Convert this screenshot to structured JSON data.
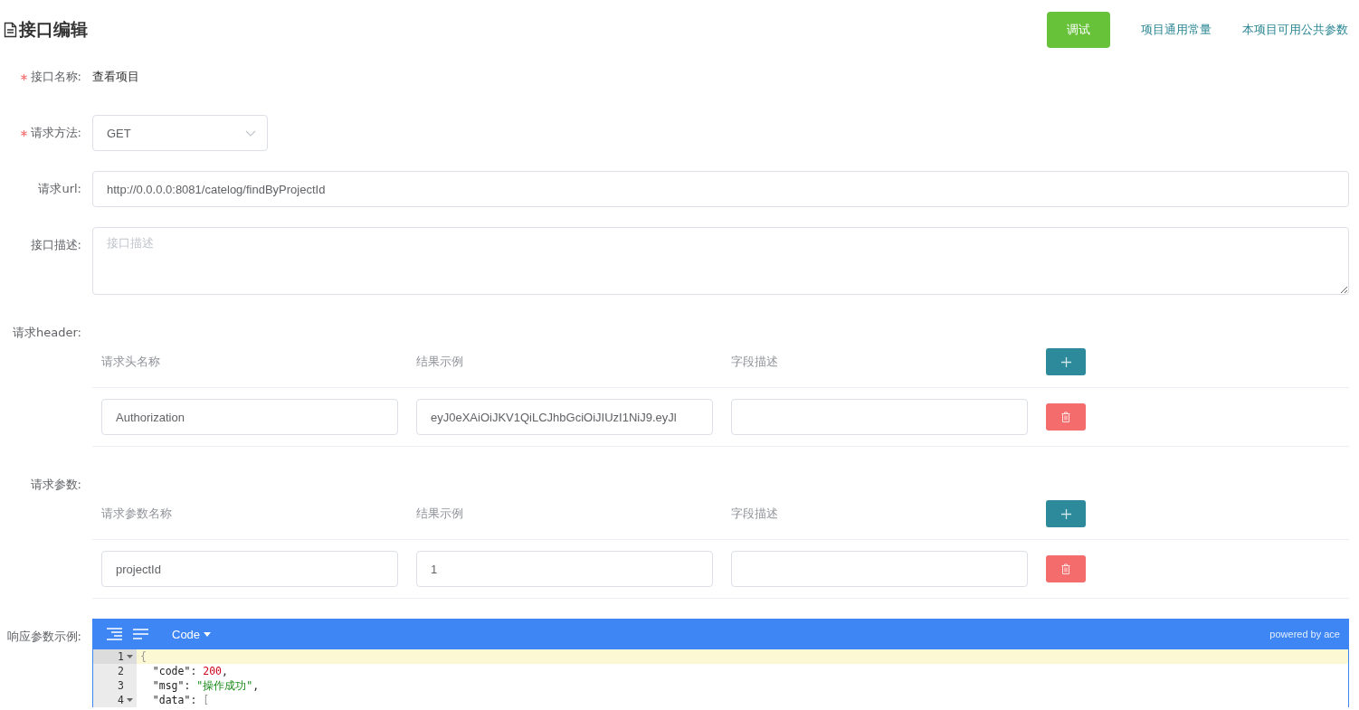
{
  "header": {
    "title": "接口编辑",
    "actions": [
      {
        "kind": "button",
        "label": "调试"
      },
      {
        "kind": "link",
        "label": "项目通用常量"
      },
      {
        "kind": "link",
        "label": "本项目可用公共参数"
      }
    ]
  },
  "fields": [
    {
      "kind": "text",
      "label": "接口名称:",
      "required": true,
      "value": "查看项目"
    },
    {
      "kind": "select",
      "label": "请求方法:",
      "required": true,
      "value": "GET"
    },
    {
      "kind": "input",
      "label": "请求url:",
      "required": false,
      "value": "http://0.0.0.0:8081/catelog/findByProjectId"
    },
    {
      "kind": "textarea",
      "label": "接口描述:",
      "required": false,
      "placeholder": "接口描述"
    },
    {
      "kind": "table",
      "label": "请求header:",
      "required": false,
      "columns": [
        "请求头名称",
        "结果示例",
        "字段描述"
      ],
      "rows": [
        {
          "name": "Authorization",
          "example": "eyJ0eXAiOiJKV1QiLCJhbGciOiJIUzI1NiJ9.eyJl"
        }
      ]
    },
    {
      "kind": "table",
      "label": "请求参数:",
      "required": false,
      "columns": [
        "请求参数名称",
        "结果示例",
        "字段描述"
      ],
      "rows": [
        {
          "name": "projectId",
          "example": "1"
        }
      ]
    },
    {
      "kind": "editor",
      "label": "响应参数示例:",
      "required": false,
      "editor": {
        "mode": "Code",
        "credit": "powered by ace",
        "lines": [
          {
            "number": "1",
            "foldable": true,
            "active": true,
            "tokens": [
              {
                "kind": "bracket",
                "text": "{"
              }
            ]
          },
          {
            "number": "2",
            "foldable": false,
            "active": false,
            "tokens": [
              {
                "kind": "key",
                "text": "  \"code\""
              },
              {
                "kind": "punct",
                "text": ": "
              },
              {
                "kind": "number",
                "text": "200"
              },
              {
                "kind": "punct",
                "text": ","
              }
            ]
          },
          {
            "number": "3",
            "foldable": false,
            "active": false,
            "tokens": [
              {
                "kind": "key",
                "text": "  \"msg\""
              },
              {
                "kind": "punct",
                "text": ": "
              },
              {
                "kind": "string",
                "text": "\"操作成功\""
              },
              {
                "kind": "punct",
                "text": ","
              }
            ]
          },
          {
            "number": "4",
            "foldable": true,
            "active": false,
            "tokens": [
              {
                "kind": "key",
                "text": "  \"data\""
              },
              {
                "kind": "punct",
                "text": ": "
              },
              {
                "kind": "bracket",
                "text": "["
              }
            ]
          }
        ]
      }
    }
  ]
}
